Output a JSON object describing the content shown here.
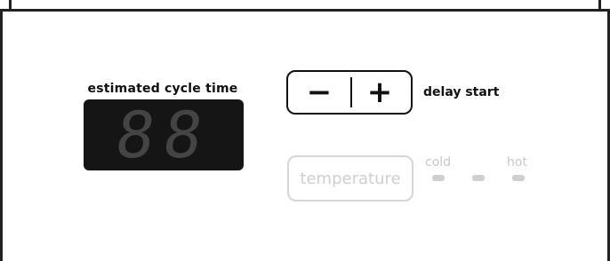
{
  "estimated_cycle_time": {
    "label": "estimated cycle time",
    "display_value": "88"
  },
  "delay_start": {
    "minus_label": "−",
    "plus_label": "+",
    "label": "delay start"
  },
  "temperature": {
    "button_label": "temperature",
    "cold_label": "cold",
    "hot_label": "hot",
    "indicators": [
      "",
      "",
      ""
    ]
  },
  "colors": {
    "display_bg": "#151515",
    "display_digits": "#444444",
    "text": "#111111",
    "disabled": "#cfcfcf"
  }
}
